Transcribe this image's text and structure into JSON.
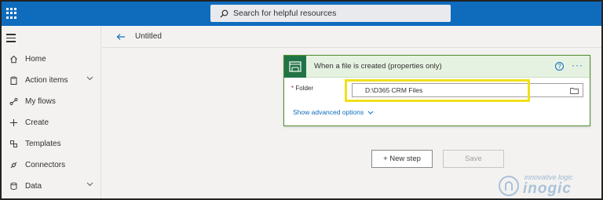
{
  "header": {
    "search_placeholder": "Search for helpful resources",
    "accent": "#0f6cbd"
  },
  "sidebar": {
    "items": [
      {
        "label": "Home",
        "icon": "home-icon"
      },
      {
        "label": "Action items",
        "icon": "clipboard-icon",
        "expandable": true
      },
      {
        "label": "My flows",
        "icon": "flow-icon"
      },
      {
        "label": "Create",
        "icon": "plus-icon"
      },
      {
        "label": "Templates",
        "icon": "templates-icon"
      },
      {
        "label": "Connectors",
        "icon": "connector-icon"
      },
      {
        "label": "Data",
        "icon": "database-icon",
        "expandable": true
      }
    ]
  },
  "main": {
    "flow_title": "Untitled"
  },
  "trigger_card": {
    "title": "When a file is created (properties only)",
    "help_glyph": "?",
    "more_glyph": "···",
    "folder_label": "Folder",
    "required_mark": "*",
    "folder_value": "D:\\D365 CRM Files",
    "advanced_label": "Show advanced options",
    "card_accent": "#217346",
    "highlight_color": "#f0e01c"
  },
  "actions": {
    "new_step_label": "+ New step",
    "save_label": "Save"
  },
  "watermark": {
    "line1": "innovative logic",
    "line2": "inogic"
  }
}
